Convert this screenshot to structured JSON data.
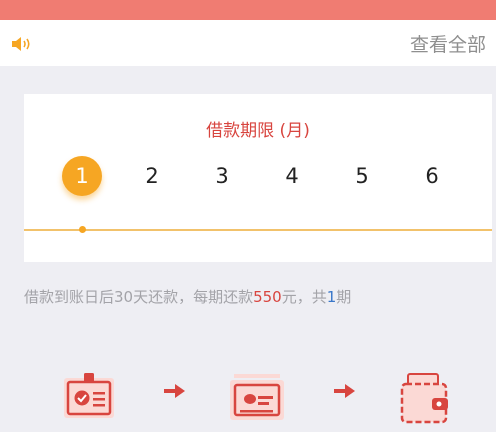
{
  "notice": {
    "speaker_icon": "speaker-icon",
    "view_all": "查看全部"
  },
  "period": {
    "title": "借款期限 (月)",
    "months": [
      "1",
      "2",
      "3",
      "4",
      "5",
      "6"
    ],
    "selected_index": 0
  },
  "summary": {
    "part1": "借款到账日后30天还款，每期还款",
    "amount": "550",
    "part2": "元，共",
    "count": "1",
    "part3": "期"
  },
  "steps": {
    "icons": [
      "id-card-icon",
      "arrow-right-icon",
      "bank-card-icon",
      "arrow-right-icon",
      "wallet-icon"
    ]
  },
  "colors": {
    "accent": "#d8453f",
    "highlight": "#f6a623",
    "link": "#3a77c9",
    "header": "#f07c72"
  }
}
